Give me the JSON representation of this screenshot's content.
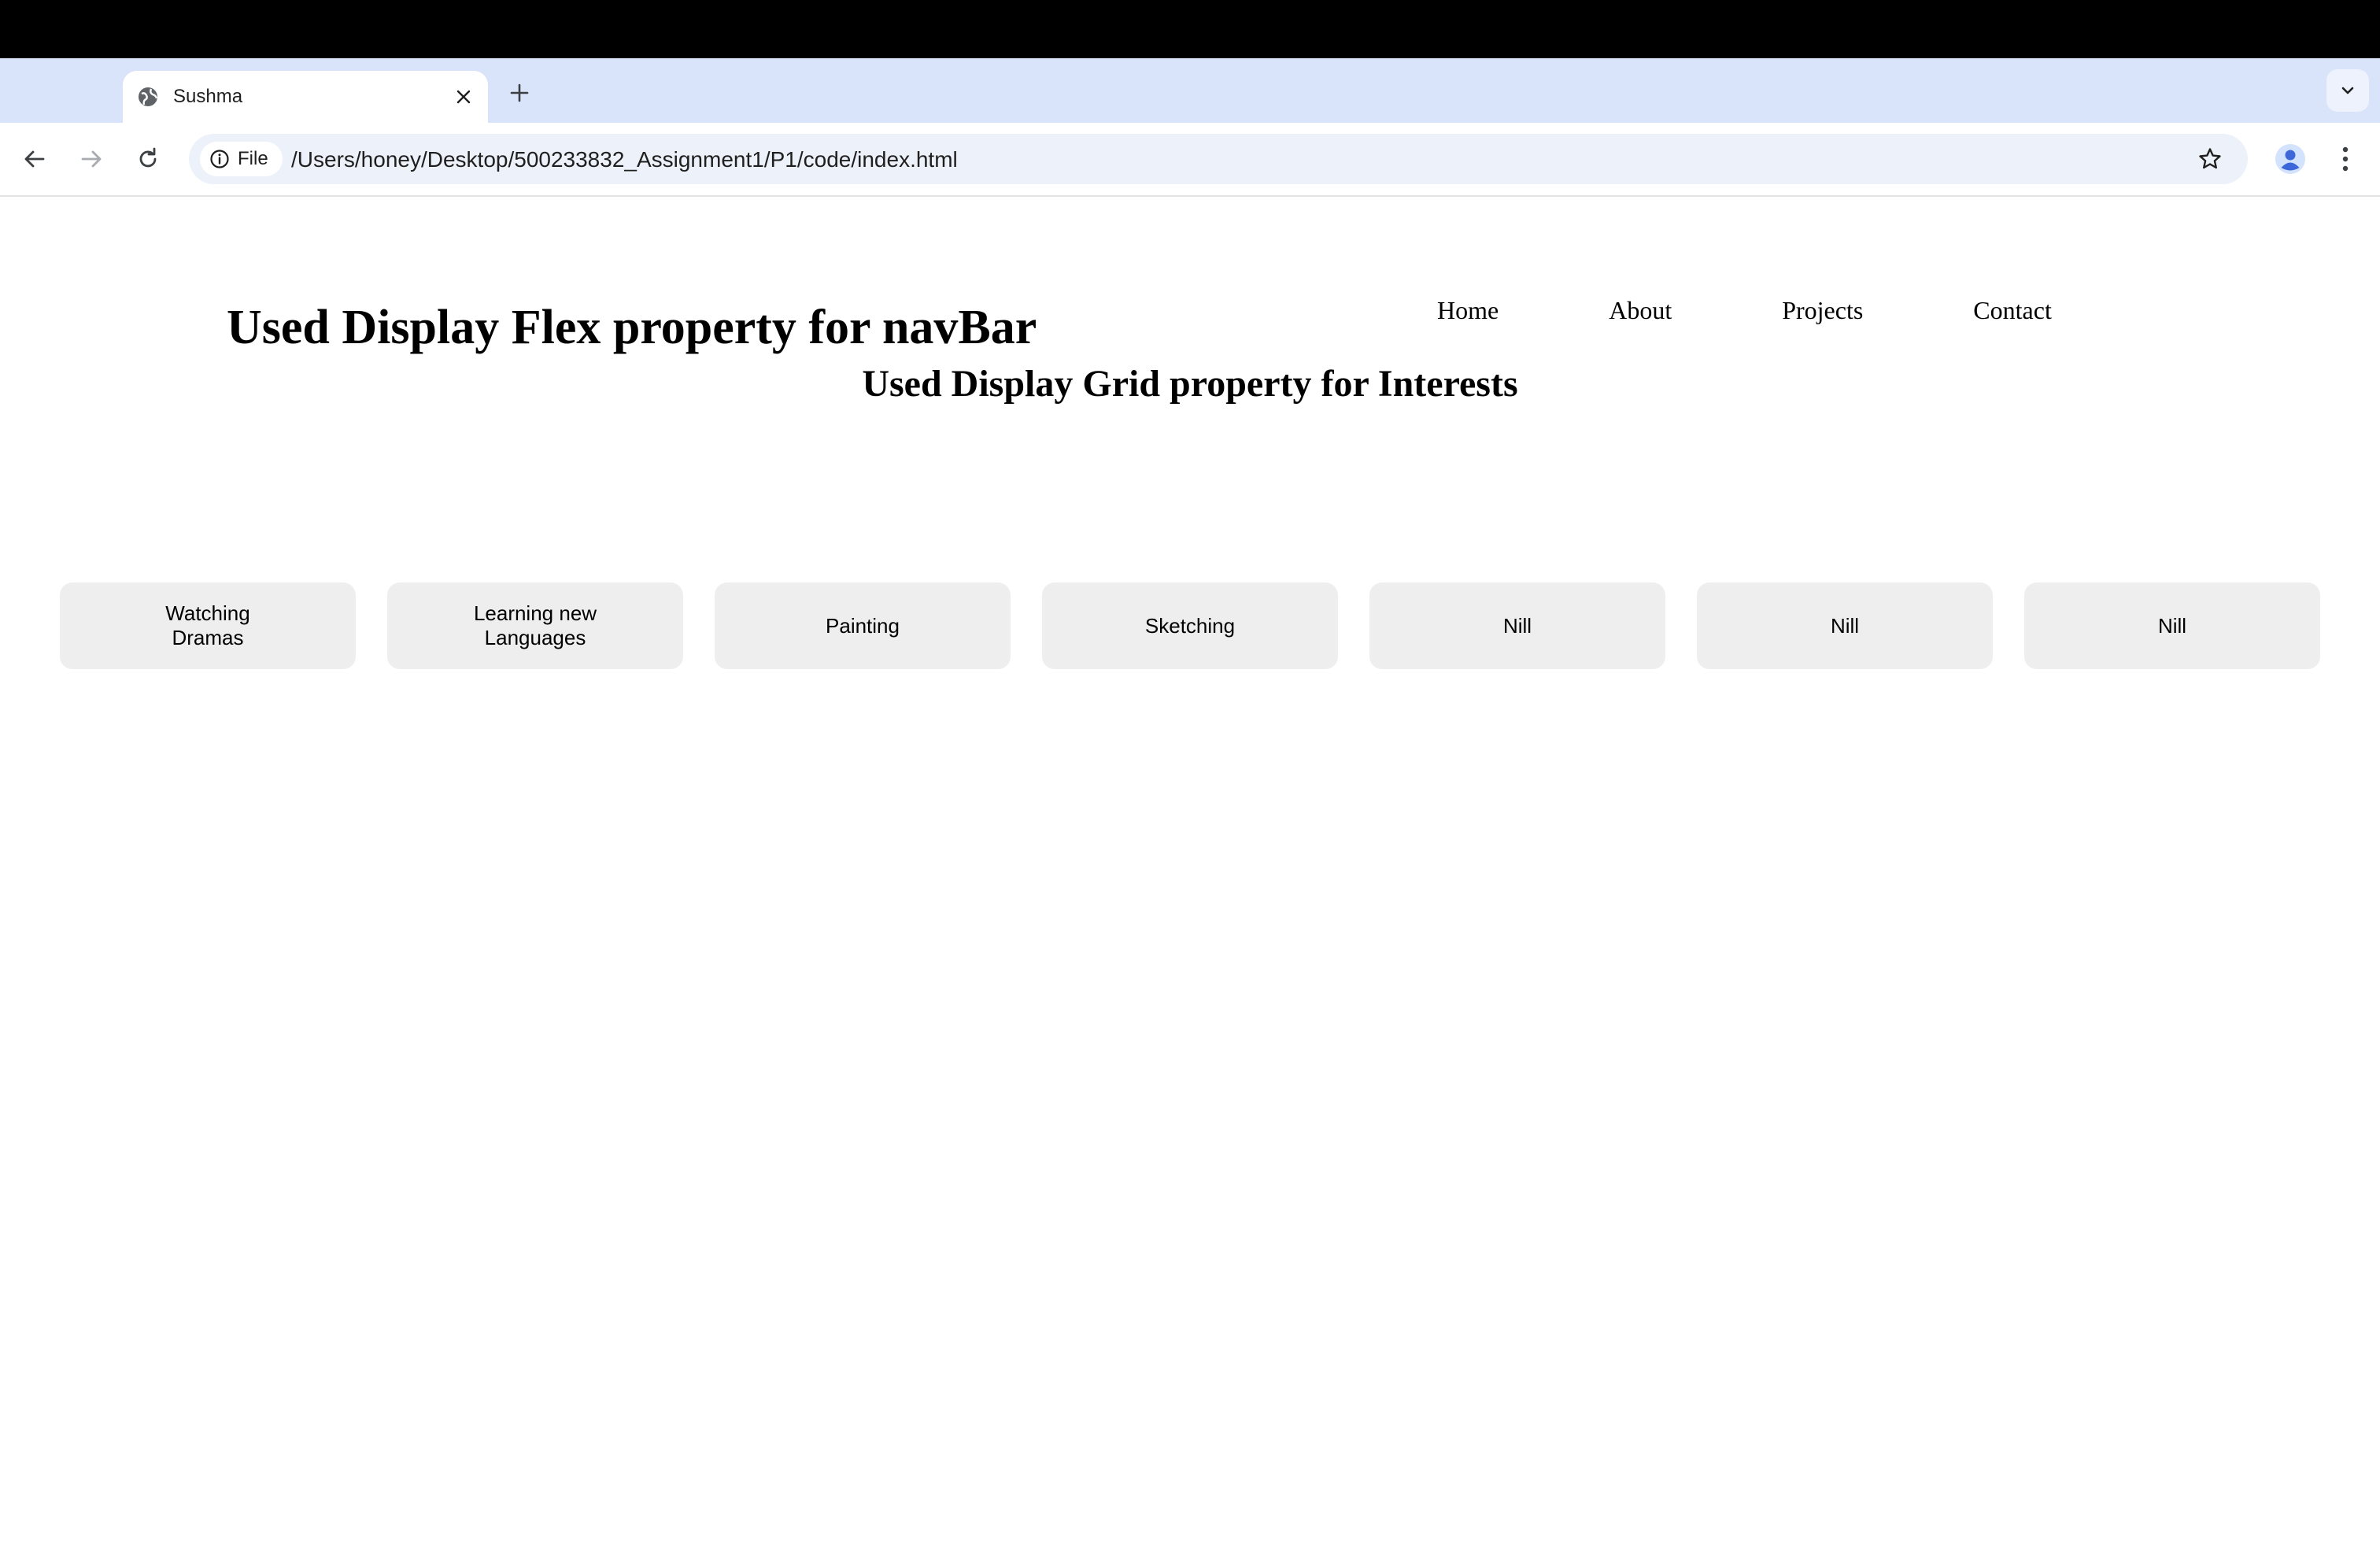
{
  "browser": {
    "tab_title": "Sushma",
    "site_chip_label": "File",
    "url": "/Users/honey/Desktop/500233832_Assignment1/P1/code/index.html",
    "icons": {
      "favicon": "globe-icon",
      "close": "close-icon",
      "new_tab": "plus-icon",
      "tab_search": "chevron-down-icon",
      "back": "arrow-left-icon",
      "forward": "arrow-right-icon",
      "reload": "reload-icon",
      "info": "info-icon",
      "bookmark": "star-icon",
      "profile": "person-icon",
      "menu": "more-vertical-icon"
    },
    "colors": {
      "tab_strip": "#d9e3f9",
      "omnibox": "#edf2fa",
      "profile_accent": "#3c67d8"
    }
  },
  "page": {
    "title": "Used Display Flex property for navBar",
    "nav": [
      {
        "label": "Home"
      },
      {
        "label": "About"
      },
      {
        "label": "Projects"
      },
      {
        "label": "Contact"
      }
    ],
    "subtitle": "Used Display Grid property for Interests",
    "interests": [
      {
        "label": "Watching Dramas"
      },
      {
        "label": "Learning new Languages"
      },
      {
        "label": "Painting"
      },
      {
        "label": "Sketching"
      },
      {
        "label": "Nill"
      },
      {
        "label": "Nill"
      },
      {
        "label": "Nill"
      }
    ],
    "colors": {
      "card_background": "#eeeeee"
    }
  }
}
